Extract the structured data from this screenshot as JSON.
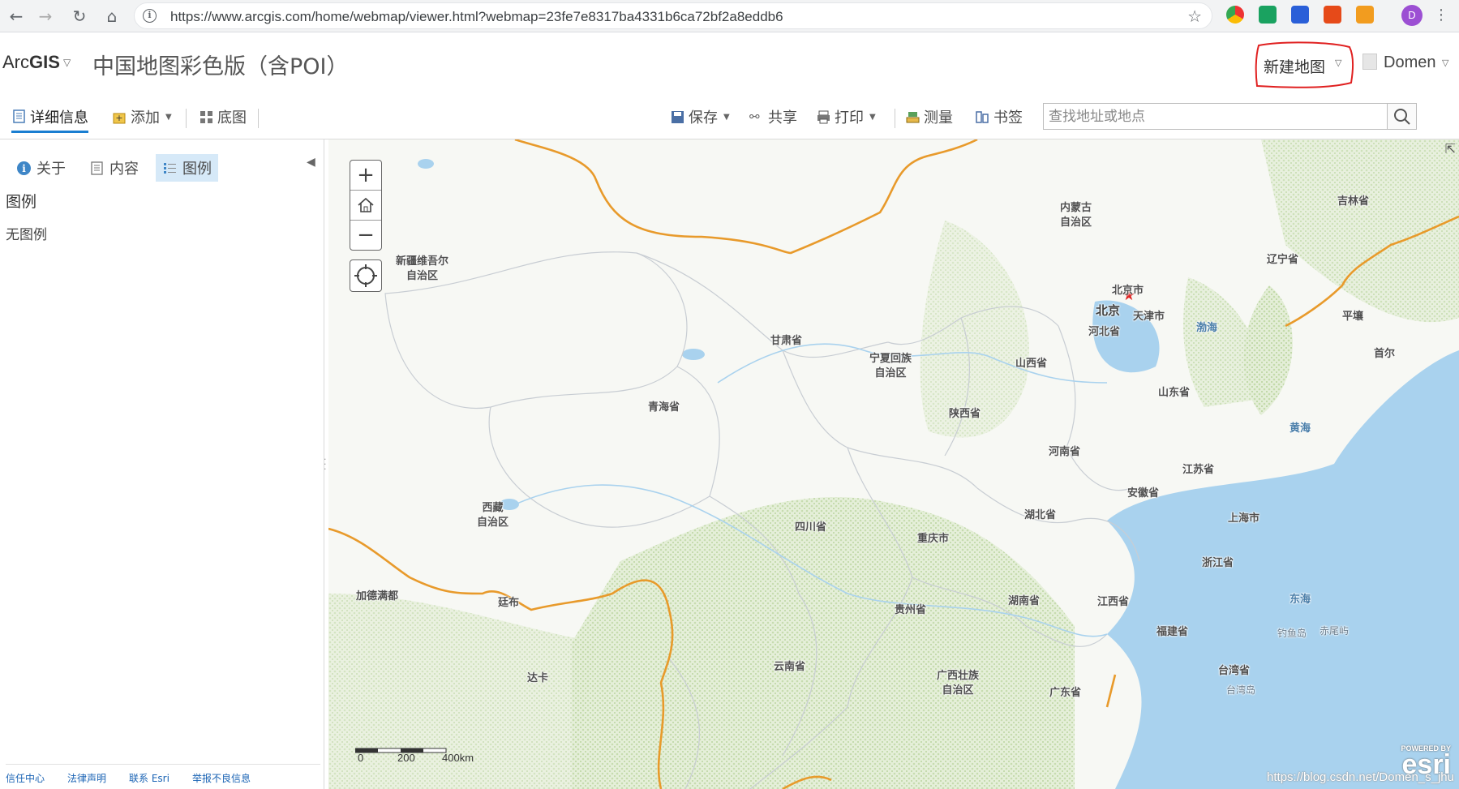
{
  "browser": {
    "url": "https://www.arcgis.com/home/webmap/viewer.html?webmap=23fe7e8317ba4331b6ca72bf2a8eddb6",
    "profile_initial": "D"
  },
  "header": {
    "brand_prefix": "Arc",
    "brand_suffix": "GIS",
    "map_title": "中国地图彩色版（含POI）",
    "new_map_label": "新建地图",
    "user_name": "Domen"
  },
  "toolbar": {
    "details_label": "详细信息",
    "add_label": "添加",
    "basemap_label": "底图",
    "save_label": "保存",
    "share_label": "共享",
    "print_label": "打印",
    "measure_label": "测量",
    "bookmarks_label": "书签",
    "search_placeholder": "查找地址或地点"
  },
  "panel": {
    "tabs": [
      {
        "label": "关于"
      },
      {
        "label": "内容"
      },
      {
        "label": "图例"
      }
    ],
    "legend_heading": "图例",
    "legend_empty": "无图例",
    "footer_links": [
      "信任中心",
      "法律声明",
      "联系 Esri",
      "举报不良信息"
    ]
  },
  "map": {
    "labels": {
      "neimenggu_1": "内蒙古",
      "neimenggu_2": "自治区",
      "jilin": "吉林省",
      "xinjiang_1": "新疆维吾尔",
      "xinjiang_2": "自治区",
      "liaoning": "辽宁省",
      "beijing_city": "北京市",
      "beijing": "北京",
      "tianjin": "天津市",
      "hebei": "河北省",
      "bohai": "渤海",
      "pyongyang": "平壤",
      "seoul": "首尔",
      "gansu": "甘肃省",
      "ningxia_1": "宁夏回族",
      "ningxia_2": "自治区",
      "shanxi": "山西省",
      "shandong": "山东省",
      "qinghai": "青海省",
      "shaanxi": "陕西省",
      "yellow_sea": "黄海",
      "henan": "河南省",
      "jiangsu": "江苏省",
      "anhui": "安徽省",
      "xizang_1": "西藏",
      "xizang_2": "自治区",
      "hubei": "湖北省",
      "shanghai": "上海市",
      "sichuan": "四川省",
      "chongqing": "重庆市",
      "zhejiang": "浙江省",
      "kathmandu": "加德满都",
      "thimphu": "廷布",
      "guizhou": "贵州省",
      "hunan": "湖南省",
      "jiangxi": "江西省",
      "east_sea": "东海",
      "fujian": "福建省",
      "diaoyu": "钓鱼岛",
      "chiwei": "赤尾屿",
      "yunnan": "云南省",
      "dhaka": "达卡",
      "guangxi_1": "广西壮族",
      "guangxi_2": "自治区",
      "guangdong": "广东省",
      "taiwan_province": "台湾省",
      "taiwan_island": "台湾岛"
    },
    "scale": {
      "s0": "0",
      "s1": "200",
      "s2": "400km"
    },
    "watermark": "https://blog.csdn.net/Domen_s_jhu",
    "esri_powered": "POWERED BY",
    "esri_name": "esri",
    "colors": {
      "land": "#f7f8f4",
      "vegetation": "#d3e4bf",
      "water": "#a9d2ee",
      "border": "#e89a2b",
      "province_line": "#c8cdd3",
      "accent": "#1a7ed1",
      "annotation_red": "#e02020"
    }
  }
}
